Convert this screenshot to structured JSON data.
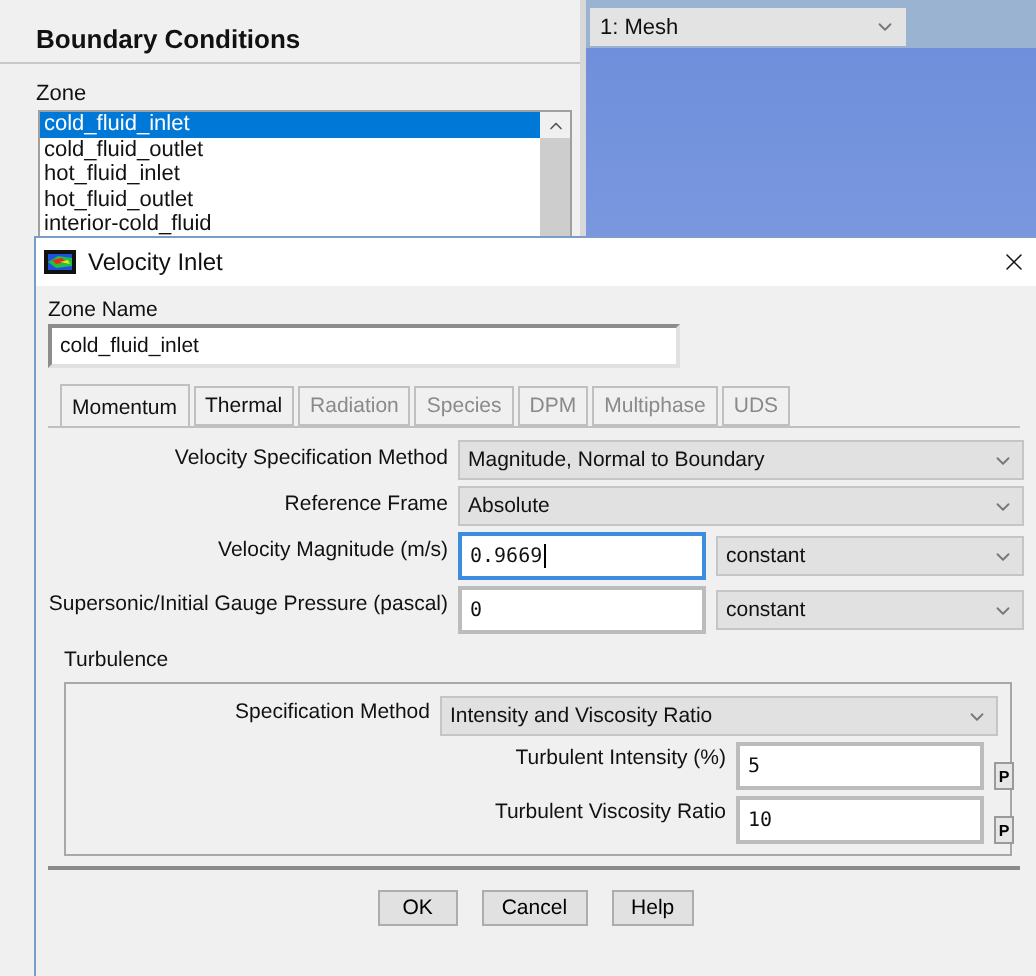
{
  "panel": {
    "title": "Boundary Conditions",
    "zone_label": "Zone",
    "zones": [
      {
        "label": "cold_fluid_inlet",
        "selected": true
      },
      {
        "label": "cold_fluid_outlet",
        "selected": false
      },
      {
        "label": "hot_fluid_inlet",
        "selected": false
      },
      {
        "label": "hot_fluid_outlet",
        "selected": false
      },
      {
        "label": "interior-cold_fluid",
        "selected": false
      }
    ]
  },
  "viewport": {
    "view_select": "1: Mesh"
  },
  "dialog": {
    "title": "Velocity Inlet",
    "zone_name_label": "Zone Name",
    "zone_name": "cold_fluid_inlet",
    "tabs": [
      {
        "label": "Momentum",
        "selected": true,
        "disabled": false
      },
      {
        "label": "Thermal",
        "selected": false,
        "disabled": false
      },
      {
        "label": "Radiation",
        "selected": false,
        "disabled": true
      },
      {
        "label": "Species",
        "selected": false,
        "disabled": true
      },
      {
        "label": "DPM",
        "selected": false,
        "disabled": true
      },
      {
        "label": "Multiphase",
        "selected": false,
        "disabled": true
      },
      {
        "label": "UDS",
        "selected": false,
        "disabled": true
      }
    ],
    "fields": [
      {
        "kind": "select",
        "label": "Velocity Specification Method",
        "value": "Magnitude, Normal to Boundary"
      },
      {
        "kind": "select",
        "label": "Reference Frame",
        "value": "Absolute"
      },
      {
        "kind": "input_profile",
        "label": "Velocity Magnitude (m/s)",
        "value": "0.9669",
        "profile": "constant",
        "focused": true
      },
      {
        "kind": "input_profile",
        "label": "Supersonic/Initial Gauge Pressure (pascal)",
        "value": "0",
        "profile": "constant",
        "focused": false
      }
    ],
    "turbulence": {
      "title": "Turbulence",
      "method_label": "Specification Method",
      "method": "Intensity and Viscosity Ratio",
      "params": [
        {
          "label": "Turbulent Intensity (%)",
          "value": "5",
          "button": "P"
        },
        {
          "label": "Turbulent Viscosity Ratio",
          "value": "10",
          "button": "P"
        }
      ]
    },
    "buttons": [
      "OK",
      "Cancel",
      "Help"
    ]
  }
}
